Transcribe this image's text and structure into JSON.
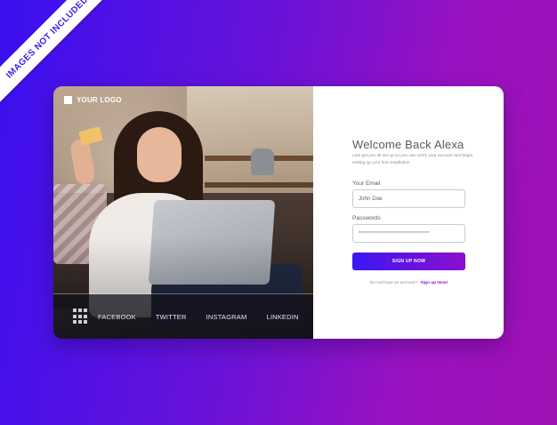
{
  "ribbon": {
    "text": "IMAGES NOT INCLUDED"
  },
  "brand": {
    "logo_text": "YOUR LOGO"
  },
  "social": {
    "items": [
      "FACEBOOK",
      "TWITTER",
      "INSTAGRAM",
      "LINKEDIN"
    ],
    "menu_icon": "grid-icon"
  },
  "form": {
    "title": "Welcome Back Alexa",
    "subtitle": "Lets get you all set up so you can verify your account and begin setting up your first installation",
    "email_label": "Your Email",
    "email_value": "John Doe",
    "password_label": "Passwords",
    "password_value": "**********************************",
    "submit_label": "SIGN UP NOW",
    "no_account_text": "Do not have an account?",
    "signup_link": "Sign up Now!"
  },
  "colors": {
    "accent_start": "#3b17f2",
    "accent_end": "#8c10cc",
    "link": "#8b12c8"
  }
}
